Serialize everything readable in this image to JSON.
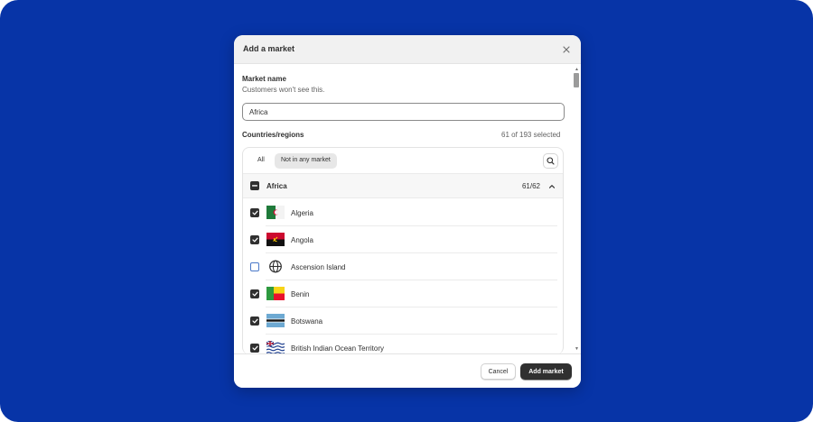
{
  "modal": {
    "title": "Add a market",
    "close_icon": "close-icon"
  },
  "market_name": {
    "label": "Market name",
    "help_text": "Customers won't see this.",
    "value": "Africa"
  },
  "regions": {
    "label": "Countries/regions",
    "selected_summary": "61 of 193 selected",
    "filters": [
      "All",
      "Not in any market"
    ],
    "active_filter": "Not in any market",
    "search_icon": "search-icon",
    "group": {
      "name": "Africa",
      "count": "61/62",
      "state": "indeterminate",
      "chevron_icon": "chevron-up-icon"
    },
    "countries": [
      {
        "name": "Algeria",
        "checked": true,
        "flag": "dz-flag-icon"
      },
      {
        "name": "Angola",
        "checked": true,
        "flag": "ao-flag-icon"
      },
      {
        "name": "Ascension Island",
        "checked": false,
        "flag": "globe-icon"
      },
      {
        "name": "Benin",
        "checked": true,
        "flag": "bj-flag-icon"
      },
      {
        "name": "Botswana",
        "checked": true,
        "flag": "bw-flag-icon"
      },
      {
        "name": "British Indian Ocean Territory",
        "checked": true,
        "flag": "io-flag-icon"
      }
    ]
  },
  "footer": {
    "cancel_label": "Cancel",
    "add_label": "Add market"
  },
  "colors": {
    "background": "#0734a7",
    "primary_button": "#303030",
    "checkbox_checked": "#303030",
    "checkbox_focus": "#4a78c8"
  }
}
